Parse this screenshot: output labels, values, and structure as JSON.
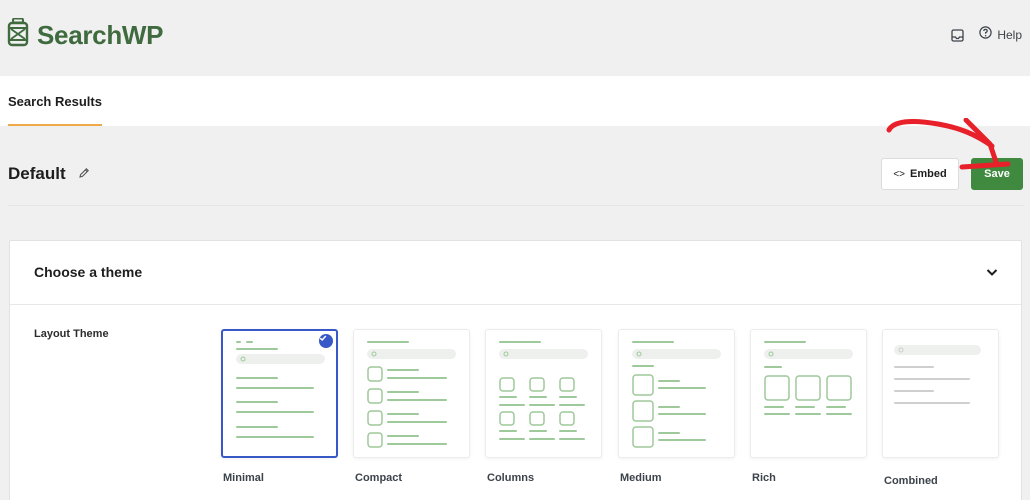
{
  "brand": {
    "name": "SearchWP",
    "logo_icon": "lantern-icon",
    "color": "#3f6b3f"
  },
  "top_actions": {
    "inbox_icon": "inbox-icon",
    "help_label": "Help"
  },
  "tabs": [
    {
      "label": "Search Results",
      "active": true
    }
  ],
  "page": {
    "title": "Default",
    "edit_icon": "pencil-icon"
  },
  "toolbar": {
    "embed_label": "Embed",
    "embed_glyph": "<>",
    "save_label": "Save",
    "save_color": "#3f8a3f"
  },
  "section": {
    "title": "Choose a theme",
    "expanded": true,
    "field_label": "Layout Theme"
  },
  "themes": [
    {
      "label": "Minimal",
      "selected": true
    },
    {
      "label": "Compact",
      "selected": false
    },
    {
      "label": "Columns",
      "selected": false
    },
    {
      "label": "Medium",
      "selected": false
    },
    {
      "label": "Rich",
      "selected": false
    },
    {
      "label": "Combined",
      "selected": false
    }
  ],
  "colors": {
    "accent_tab": "#f0a94a",
    "selected_theme": "#3858c8",
    "annotation_arrow": "#e8202a"
  }
}
